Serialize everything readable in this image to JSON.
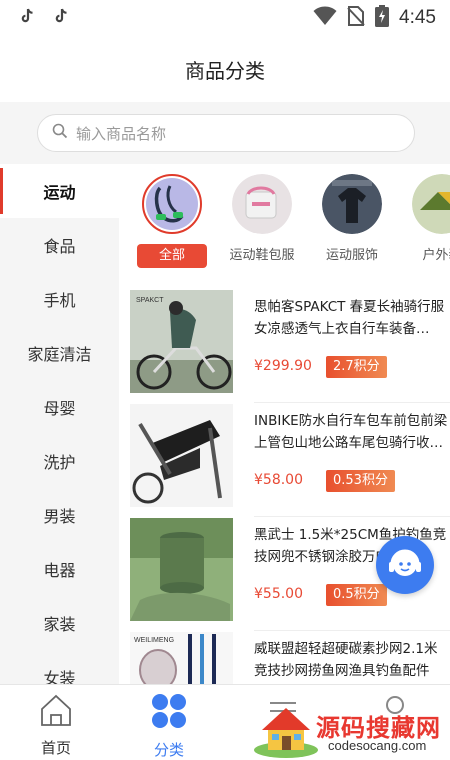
{
  "status_bar": {
    "time": "4:45"
  },
  "header": {
    "title": "商品分类"
  },
  "search": {
    "placeholder": "输入商品名称"
  },
  "sidebar": {
    "items": [
      {
        "label": "运动",
        "active": true
      },
      {
        "label": "食品"
      },
      {
        "label": "手机"
      },
      {
        "label": "家庭清洁"
      },
      {
        "label": "母婴"
      },
      {
        "label": "洗护"
      },
      {
        "label": "男装"
      },
      {
        "label": "电器"
      },
      {
        "label": "家装"
      },
      {
        "label": "女装"
      }
    ]
  },
  "subcategories": [
    {
      "label": "全部",
      "active": true
    },
    {
      "label": "运动鞋包服"
    },
    {
      "label": "运动服饰"
    },
    {
      "label": "户外装"
    }
  ],
  "products": [
    {
      "name": "思帕客SPAKCT 春夏长袖骑行服女凉感透气上衣自行车装备…",
      "price": "¥299.90",
      "points": "2.7积分"
    },
    {
      "name": "INBIKE防水自行车包车前包前梁上管包山地公路车尾包骑行收…",
      "price": "¥58.00",
      "points": "0.53积分"
    },
    {
      "name": "黑武士 1.5米*25CM鱼护钓鱼竞技网兜不锈钢涂胶万向抄网…",
      "price": "¥55.00",
      "points": "0.5积分"
    },
    {
      "name": "威联盟超轻超硬碳素抄网2.1米竞技抄网捞鱼网渔具钓鱼配件鱼…",
      "price": "",
      "points": ""
    }
  ],
  "bottom_nav": [
    {
      "label": "首页"
    },
    {
      "label": "分类",
      "active": true
    },
    {
      "label": ""
    },
    {
      "label": ""
    }
  ],
  "watermark": {
    "text": "源码搜藏网",
    "url": "codesocang.com"
  },
  "colors": {
    "accent": "#e84a35",
    "active_blue": "#3d7cf0"
  }
}
